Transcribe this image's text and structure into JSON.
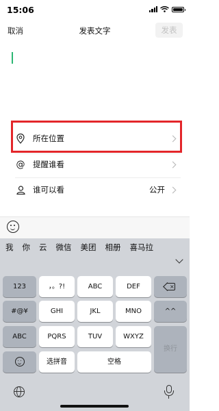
{
  "status_bar": {
    "time": "15:06"
  },
  "nav": {
    "cancel": "取消",
    "title": "发表文字",
    "publish": "发表"
  },
  "options": [
    {
      "icon": "location-pin-icon",
      "label": "所在位置",
      "value": ""
    },
    {
      "icon": "at-icon",
      "label": "提醒谁看",
      "value": ""
    },
    {
      "icon": "user-icon",
      "label": "谁可以看",
      "value": "公开"
    }
  ],
  "highlight_color": "#e3262a",
  "accent_color": "#2bb673",
  "candidates": [
    "我",
    "你",
    "云",
    "微信",
    "美团",
    "相册",
    "喜马拉"
  ],
  "keyboard": {
    "row1": [
      "123",
      "，。?!",
      "ABC",
      "DEF"
    ],
    "row2": [
      "#@¥",
      "GHI",
      "JKL",
      "MNO",
      "^^"
    ],
    "row3": [
      "ABC",
      "PQRS",
      "TUV",
      "WXYZ",
      "换行"
    ],
    "row4": [
      "选拼音",
      "空格"
    ]
  }
}
